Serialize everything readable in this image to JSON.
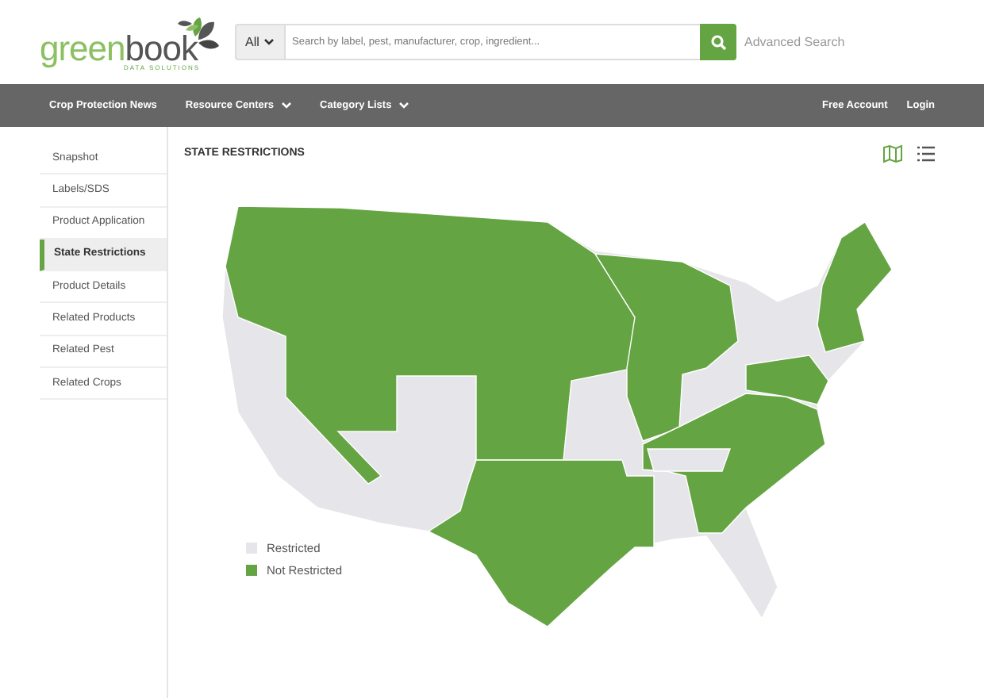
{
  "logo": {
    "word_light": "green",
    "word_dark": "book",
    "tagline": "DATA SOLUTIONS"
  },
  "search": {
    "scope": "All",
    "placeholder": "Search by label, pest, manufacturer, crop, ingredient...",
    "advanced_link": "Advanced Search"
  },
  "nav": {
    "left": [
      {
        "label": "Crop Protection News",
        "has_menu": false
      },
      {
        "label": "Resource Centers",
        "has_menu": true
      },
      {
        "label": "Category Lists",
        "has_menu": true
      }
    ],
    "right": [
      "Free Account",
      "Login"
    ]
  },
  "sidebar": {
    "items": [
      {
        "label": "Snapshot",
        "selected": false
      },
      {
        "label": "Labels/SDS",
        "selected": false
      },
      {
        "label": "Product Application",
        "selected": false
      },
      {
        "label": "State Restrictions",
        "selected": true
      },
      {
        "label": "Product Details",
        "selected": false
      },
      {
        "label": "Related Products",
        "selected": false
      },
      {
        "label": "Related Pest",
        "selected": false
      },
      {
        "label": "Related Crops",
        "selected": false
      }
    ]
  },
  "content": {
    "title": "STATE RESTRICTIONS",
    "views": [
      {
        "kind": "map",
        "selected": true
      },
      {
        "kind": "list",
        "selected": false
      }
    ],
    "legend": [
      {
        "label": "Restricted",
        "color": "#e6e6ea"
      },
      {
        "label": "Not Restricted",
        "color": "#65a443"
      }
    ]
  }
}
